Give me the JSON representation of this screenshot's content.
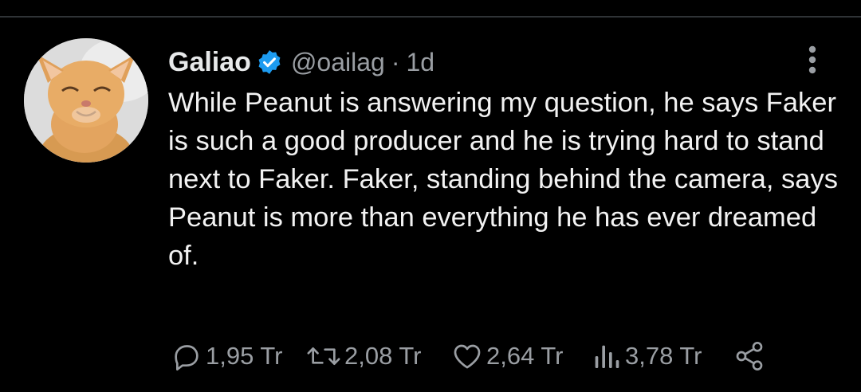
{
  "tweet": {
    "author_name": "Galiao",
    "handle": "@oailag",
    "separator": "·",
    "time": "1d",
    "verified": true,
    "text": "While Peanut is answering my question, he says Faker is such a good producer and he is trying hard to stand next to Faker. Faker, standing behind the camera, says Peanut is more than everything he has ever dreamed of."
  },
  "actions": {
    "reply_count": "1,95 Tr",
    "retweet_count": "2,08 Tr",
    "like_count": "2,64 Tr",
    "views_count": "3,78 Tr"
  },
  "icons": {
    "verified": "verified-badge-icon",
    "more": "more-vertical-icon",
    "reply": "reply-icon",
    "retweet": "retweet-icon",
    "like": "heart-icon",
    "views": "views-bar-chart-icon",
    "share": "share-icon"
  },
  "colors": {
    "background": "#000000",
    "text": "#e7e9ea",
    "muted": "#9a9ea3",
    "verified": "#1d9bf0",
    "divider": "#2f3336"
  }
}
